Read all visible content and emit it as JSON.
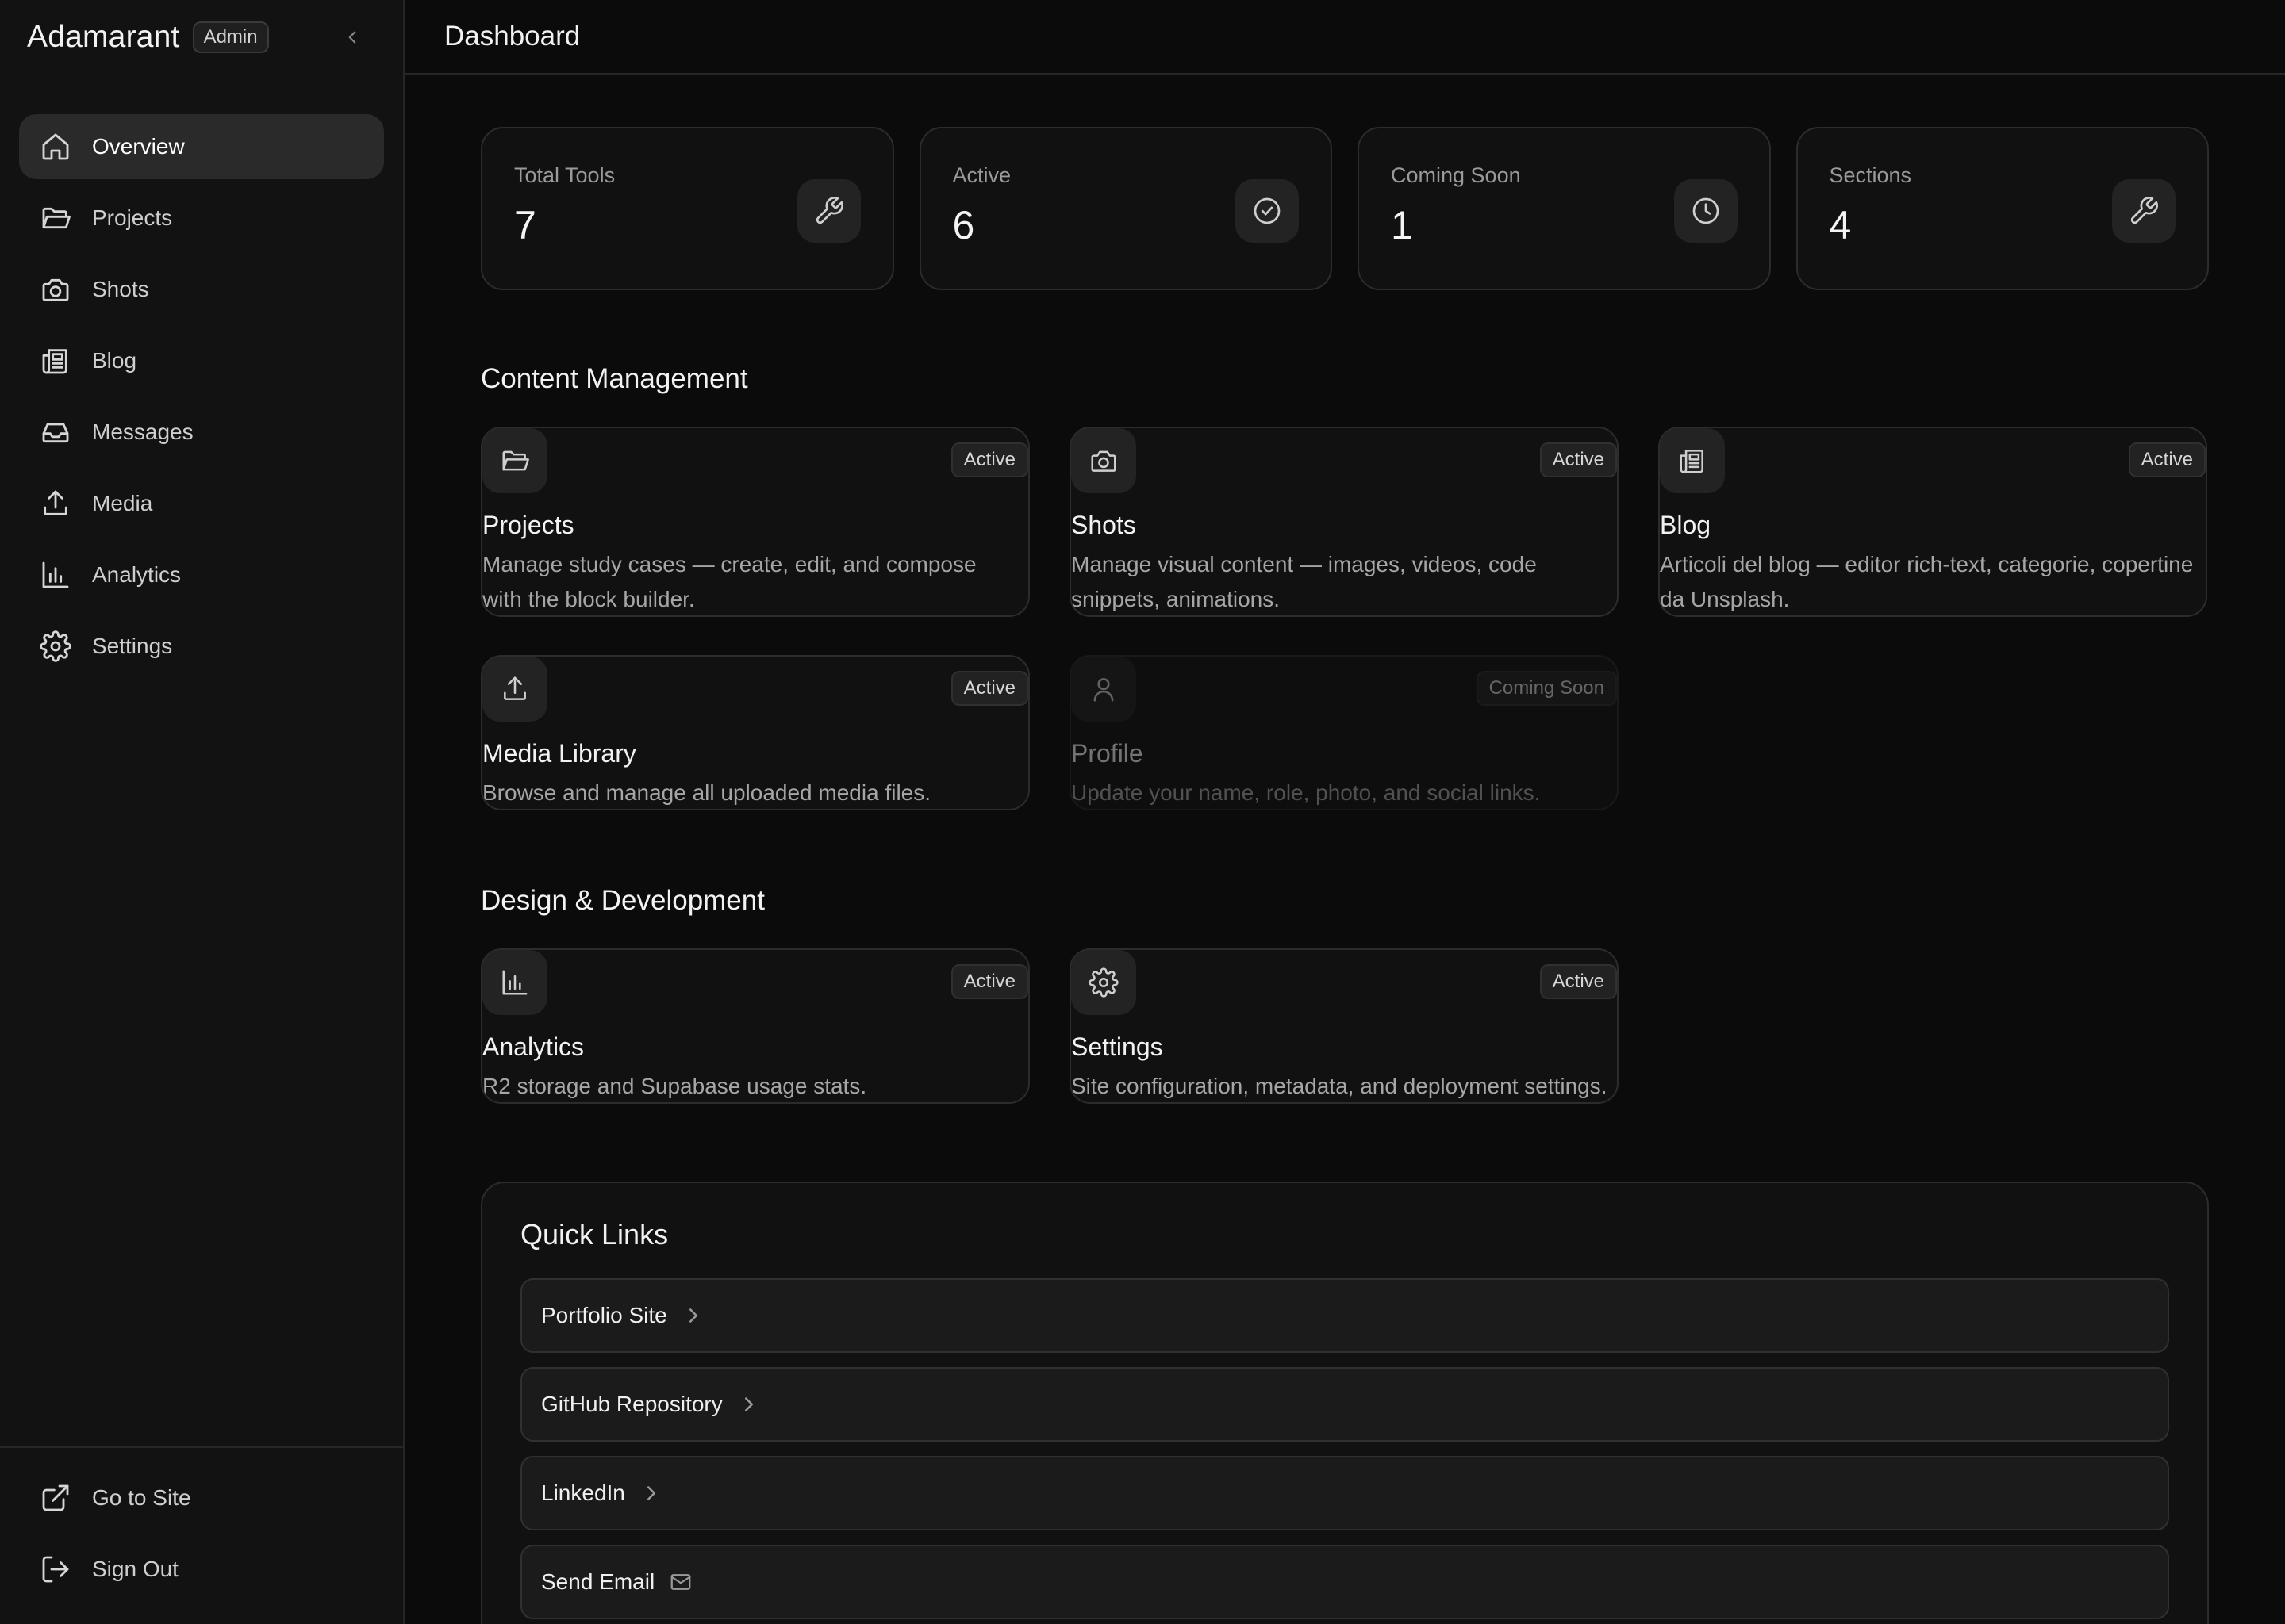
{
  "sidebar": {
    "brand": "Adamarant",
    "badge": "Admin",
    "nav": [
      {
        "label": "Overview",
        "icon": "home-icon",
        "active": true
      },
      {
        "label": "Projects",
        "icon": "folder-icon"
      },
      {
        "label": "Shots",
        "icon": "camera-icon"
      },
      {
        "label": "Blog",
        "icon": "newspaper-icon"
      },
      {
        "label": "Messages",
        "icon": "inbox-icon"
      },
      {
        "label": "Media",
        "icon": "upload-icon"
      },
      {
        "label": "Analytics",
        "icon": "bar-chart-icon"
      },
      {
        "label": "Settings",
        "icon": "gear-icon"
      }
    ],
    "footer": [
      {
        "label": "Go to Site",
        "icon": "external-link-icon"
      },
      {
        "label": "Sign Out",
        "icon": "sign-out-icon"
      }
    ]
  },
  "header": {
    "title": "Dashboard"
  },
  "stats": [
    {
      "label": "Total Tools",
      "value": "7",
      "icon": "wrench-icon"
    },
    {
      "label": "Active",
      "value": "6",
      "icon": "check-circle-icon"
    },
    {
      "label": "Coming Soon",
      "value": "1",
      "icon": "clock-icon"
    },
    {
      "label": "Sections",
      "value": "4",
      "icon": "wrench-icon"
    }
  ],
  "sections": [
    {
      "title": "Content Management",
      "tools": [
        {
          "name": "Projects",
          "desc": "Manage study cases — create, edit, and compose with the block builder.",
          "status": "Active",
          "icon": "folder-icon"
        },
        {
          "name": "Shots",
          "desc": "Manage visual content — images, videos, code snippets, animations.",
          "status": "Active",
          "icon": "camera-icon"
        },
        {
          "name": "Blog",
          "desc": "Articoli del blog — editor rich-text, categorie, copertine da Unsplash.",
          "status": "Active",
          "icon": "newspaper-icon"
        },
        {
          "name": "Media Library",
          "desc": "Browse and manage all uploaded media files.",
          "status": "Active",
          "icon": "upload-icon"
        },
        {
          "name": "Profile",
          "desc": "Update your name, role, photo, and social links.",
          "status": "Coming Soon",
          "icon": "user-icon"
        }
      ]
    },
    {
      "title": "Design & Development",
      "tools": [
        {
          "name": "Analytics",
          "desc": "R2 storage and Supabase usage stats.",
          "status": "Active",
          "icon": "bar-chart-icon"
        },
        {
          "name": "Settings",
          "desc": "Site configuration, metadata, and deployment settings.",
          "status": "Active",
          "icon": "gear-icon"
        }
      ]
    }
  ],
  "quick_links": {
    "title": "Quick Links",
    "items": [
      {
        "label": "Portfolio Site",
        "icon": "chevron-right-icon"
      },
      {
        "label": "GitHub Repository",
        "icon": "chevron-right-icon"
      },
      {
        "label": "LinkedIn",
        "icon": "chevron-right-icon"
      },
      {
        "label": "Send Email",
        "icon": "mail-icon"
      }
    ]
  }
}
